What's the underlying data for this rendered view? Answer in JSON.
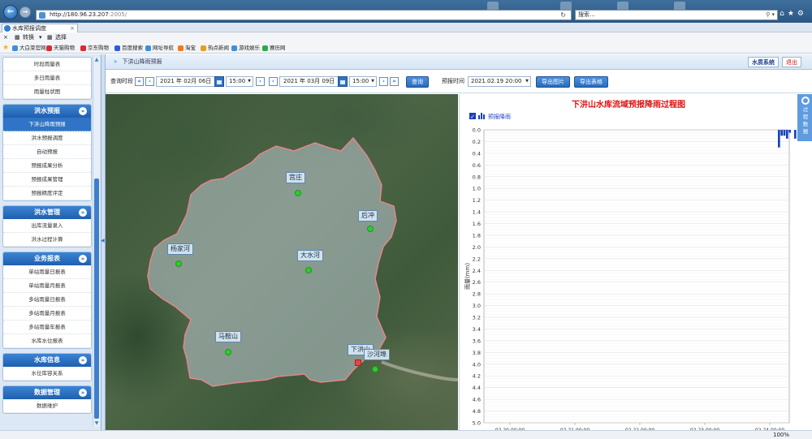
{
  "browser": {
    "url_host": "http://180.96.23.207",
    "url_port": ":2005/",
    "search_placeholder": "搜索...",
    "tab_title": "水库预报调度",
    "cmd_convert": "转换",
    "cmd_select": "选择",
    "favorites": [
      {
        "label": "大白菜官网",
        "color": "#3f8fd6"
      },
      {
        "label": "天猫购物",
        "color": "#d82c2c"
      },
      {
        "label": "京东购物",
        "color": "#d82c2c"
      },
      {
        "label": "百度搜索",
        "color": "#2f5fd8"
      },
      {
        "label": "网址导航",
        "color": "#3f8fd6"
      },
      {
        "label": "淘宝",
        "color": "#f07a1a"
      },
      {
        "label": "热点新闻",
        "color": "#e0a020"
      },
      {
        "label": "游戏娱乐",
        "color": "#3f8fd6"
      },
      {
        "label": "赛历网",
        "color": "#2faa4a"
      }
    ],
    "zoom": "100%"
  },
  "sidebar": {
    "groups": [
      {
        "title": "",
        "items": [
          "时段雨量表",
          "多日雨量表",
          "雨量柱状图"
        ],
        "active": -1
      },
      {
        "title": "洪水预报",
        "items": [
          "下汫山降雨预报",
          "洪水预报调度",
          "自动预报",
          "预报成果分析",
          "预报成果管理",
          "预报精度评定"
        ],
        "active": 0
      },
      {
        "title": "洪水管理",
        "items": [
          "出库流量录入",
          "洪水过程计算"
        ],
        "active": -1
      },
      {
        "title": "业务报表",
        "items": [
          "单站雨量日报表",
          "单站雨量月报表",
          "多站雨量日报表",
          "多站雨量月报表",
          "多站雨量年报表",
          "水库水位报表"
        ],
        "active": -1
      },
      {
        "title": "水库信息",
        "items": [
          "水位库容关系"
        ],
        "active": -1
      },
      {
        "title": "数据管理",
        "items": [
          "数据维护"
        ],
        "active": -1
      }
    ]
  },
  "header": {
    "breadcrumb": "下汫山降雨预报",
    "system_button": "水质系统",
    "exit_button": "退出"
  },
  "toolbar": {
    "query_period_label": "查询时段",
    "start_date": "2021 年  02月  06日",
    "start_time": "15:00",
    "end_date": "2021 年  03月  09日",
    "end_time": "15:00",
    "query_button": "查询",
    "forecast_time_label": "预报时间",
    "forecast_time": "2021.02.19 20:00",
    "export_image_button": "导出图片",
    "export_table_button": "导出表格"
  },
  "map": {
    "places": [
      {
        "name": "宫庄"
      },
      {
        "name": "后冲"
      },
      {
        "name": "杨家河"
      },
      {
        "name": "大水河"
      },
      {
        "name": "马鞍山"
      },
      {
        "name": "下汫山"
      },
      {
        "name": "沙河埠"
      }
    ]
  },
  "side_tab": {
    "label": "过程数据"
  },
  "chart_data": {
    "type": "bar",
    "title": "下汫山水库流域预报降雨过程图",
    "legend": "预报降雨",
    "legend_position": "top-left",
    "ylabel": "雨量(mm)",
    "y_inverted": true,
    "ylim": [
      0,
      5.0
    ],
    "yticks": [
      0.0,
      0.2,
      0.4,
      0.6,
      0.8,
      1.0,
      1.2,
      1.4,
      1.6,
      1.8,
      2.0,
      2.2,
      2.4,
      2.6,
      2.8,
      3.0,
      3.2,
      3.4,
      3.6,
      3.8,
      4.0,
      4.2,
      4.4,
      4.6,
      4.8,
      5.0
    ],
    "xticks": [
      "02.20 00:00",
      "02.21 00:00",
      "02.22 00:00",
      "02.23 00:00",
      "02.24 00:00"
    ],
    "grid": true,
    "color": "#1a3fbf",
    "bars": [
      {
        "x": "02.24 03:00",
        "value": 0.3
      },
      {
        "x": "02.24 04:00",
        "value": 0.1
      },
      {
        "x": "02.24 05:00",
        "value": 0.1
      },
      {
        "x": "02.24 06:00",
        "value": 0.15
      },
      {
        "x": "02.24 07:00",
        "value": 0.05
      },
      {
        "x": "02.24 09:00",
        "value": 0.15
      }
    ]
  }
}
